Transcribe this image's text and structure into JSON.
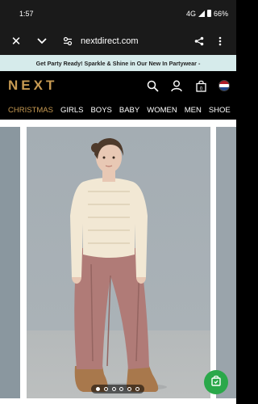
{
  "status_bar": {
    "time": "1:57",
    "network": "4G",
    "battery": "66%"
  },
  "browser": {
    "url": "nextdirect.com"
  },
  "promo": {
    "text": "Get Party Ready! Sparkle & Shine in Our New In Partywear -"
  },
  "header": {
    "logo": "NEXT"
  },
  "nav": {
    "items": [
      {
        "label": "CHRISTMAS",
        "active": true
      },
      {
        "label": "GIRLS",
        "active": false
      },
      {
        "label": "BOYS",
        "active": false
      },
      {
        "label": "BABY",
        "active": false
      },
      {
        "label": "WOMEN",
        "active": false
      },
      {
        "label": "MEN",
        "active": false
      },
      {
        "label": "SHOE",
        "active": false
      }
    ]
  },
  "carousel": {
    "slide_count": 6,
    "active_index": 0
  },
  "colors": {
    "brand_gold": "#c79a52",
    "promo_bg": "#d6ebeb",
    "fab_green": "#2aa84a"
  },
  "icons": [
    "close-icon",
    "chevron-down-icon",
    "tune-icon",
    "share-icon",
    "menu-icon",
    "search-icon",
    "account-icon",
    "bag-icon",
    "flag-icon",
    "shopping-icon"
  ]
}
